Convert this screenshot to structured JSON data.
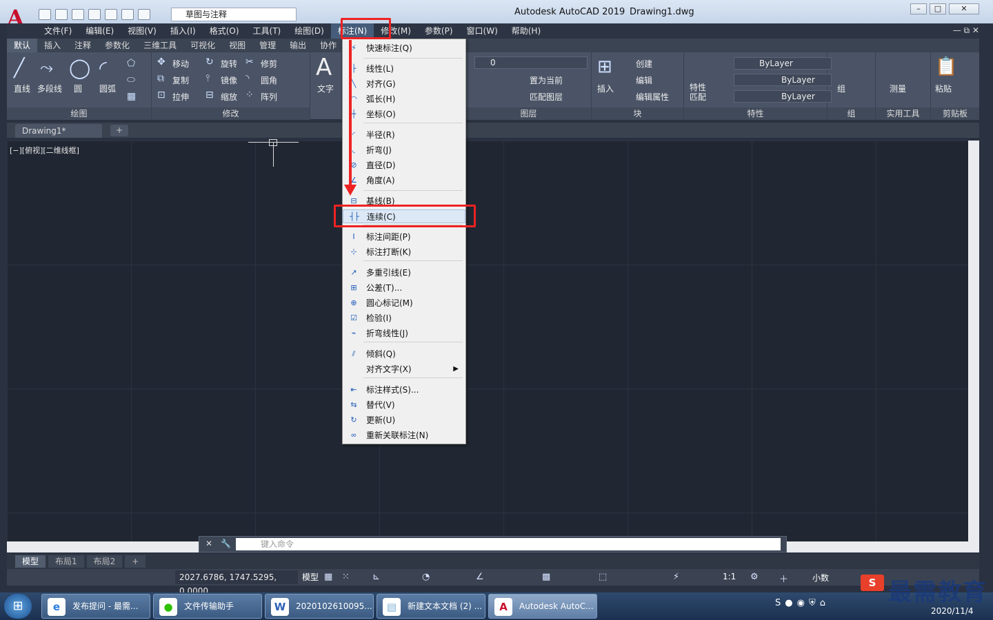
{
  "window": {
    "title": "Autodesk AutoCAD 2019",
    "document": "Drawing1.dwg",
    "app_logo": "A"
  },
  "workspace": {
    "current": "草图与注释"
  },
  "menubar": {
    "items": [
      "文件(F)",
      "编辑(E)",
      "视图(V)",
      "插入(I)",
      "格式(O)",
      "工具(T)",
      "绘图(D)",
      "标注(N)",
      "修改(M)",
      "参数(P)",
      "窗口(W)",
      "帮助(H)"
    ],
    "active": "标注(N)"
  },
  "ribbon_tabs": [
    "默认",
    "插入",
    "注释",
    "参数化",
    "三维工具",
    "可视化",
    "视图",
    "管理",
    "输出",
    "协作"
  ],
  "ribbon": {
    "draw": {
      "title": "绘图",
      "line": "直线",
      "polyline": "多段线",
      "circle": "圆",
      "arc": "圆弧"
    },
    "modify": {
      "title": "修改",
      "move": "移动",
      "rotate": "旋转",
      "trim": "修剪",
      "copy": "复制",
      "mirror": "镜像",
      "fillet": "圆角",
      "stretch": "拉伸",
      "scale": "缩放",
      "array": "阵列"
    },
    "annotation": {
      "text": "文字"
    },
    "layers": {
      "title": "图层",
      "current_layer": "0",
      "set_current": "置为当前",
      "match": "匹配图层"
    },
    "block": {
      "title": "块",
      "insert": "插入",
      "create": "创建",
      "edit": "编辑",
      "edit_attr": "编辑属性"
    },
    "properties": {
      "title": "特性",
      "match": "特性\n匹配",
      "color": "ByLayer",
      "linetype": "ByLayer",
      "lineweight": "ByLayer"
    },
    "groups": {
      "title": "组",
      "group": "组"
    },
    "utilities": {
      "title": "实用工具",
      "measure": "测量"
    },
    "clipboard": {
      "title": "剪贴板",
      "paste": "粘贴"
    }
  },
  "file_tab": {
    "name": "Drawing1*"
  },
  "viewport": {
    "label": "[−][俯视][二维线框]"
  },
  "dimension_menu": {
    "items": [
      {
        "label": "快速标注(Q)",
        "icon": "⚡"
      },
      {
        "label": "线性(L)",
        "icon": "├"
      },
      {
        "label": "对齐(G)",
        "icon": "╲"
      },
      {
        "label": "弧长(H)",
        "icon": "◠"
      },
      {
        "label": "坐标(O)",
        "icon": "┼"
      },
      {
        "label": "半径(R)",
        "icon": "◜"
      },
      {
        "label": "折弯(J)",
        "icon": "◟"
      },
      {
        "label": "直径(D)",
        "icon": "⊘"
      },
      {
        "label": "角度(A)",
        "icon": "∠"
      },
      {
        "label": "基线(B)",
        "icon": "⊟"
      },
      {
        "label": "连续(C)",
        "icon": "┤├"
      },
      {
        "label": "标注间距(P)",
        "icon": "I"
      },
      {
        "label": "标注打断(K)",
        "icon": "⊹"
      },
      {
        "label": "多重引线(E)",
        "icon": "↗"
      },
      {
        "label": "公差(T)...",
        "icon": "⊞"
      },
      {
        "label": "圆心标记(M)",
        "icon": "⊕"
      },
      {
        "label": "检验(I)",
        "icon": "☑"
      },
      {
        "label": "折弯线性(J)",
        "icon": "⌁"
      },
      {
        "label": "倾斜(Q)",
        "icon": "⫽"
      },
      {
        "label": "对齐文字(X)",
        "icon": ""
      },
      {
        "label": "标注样式(S)...",
        "icon": "⇤"
      },
      {
        "label": "替代(V)",
        "icon": "⇆"
      },
      {
        "label": "更新(U)",
        "icon": "↻"
      },
      {
        "label": "重新关联标注(N)",
        "icon": "∞"
      }
    ],
    "highlighted": "连续(C)"
  },
  "command": {
    "placeholder": "键入命令"
  },
  "layout_tabs": [
    "模型",
    "布局1",
    "布局2"
  ],
  "status": {
    "coords": "2027.6786, 1747.5295, 0.0000",
    "model": "模型",
    "scale": "1:1",
    "units": "小数"
  },
  "taskbar": {
    "items": [
      {
        "label": "发布提问 - 最需...",
        "icon": "e",
        "color": "#2a7de1"
      },
      {
        "label": "文件传输助手",
        "icon": "●",
        "color": "#2dc100"
      },
      {
        "label": "2020102610095...",
        "icon": "W",
        "color": "#2b5fb4"
      },
      {
        "label": "新建文本文档 (2) ...",
        "icon": "▤",
        "color": "#7fb2d6"
      },
      {
        "label": "Autodesk AutoC...",
        "icon": "A",
        "color": "#c8102e"
      }
    ],
    "date": "2020/11/4"
  },
  "watermark": "最需教育",
  "ime": "S",
  "colors": {
    "accent_red": "#ee2222",
    "canvas": "#212732"
  }
}
